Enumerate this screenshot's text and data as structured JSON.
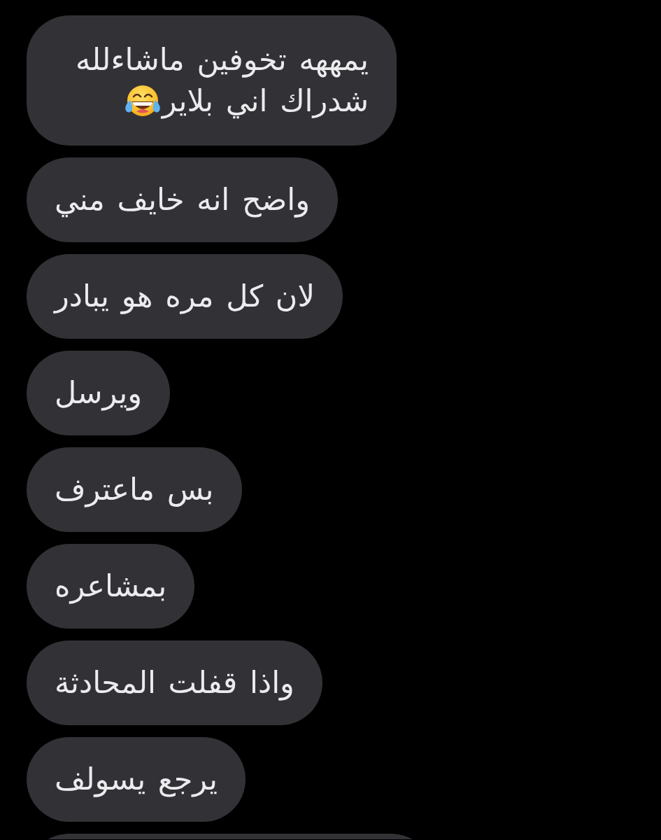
{
  "messages": [
    {
      "kind": "text",
      "lines": [
        "يمههه تخوفين ماشاءلله",
        "شدراك اني بلاير"
      ],
      "emoji": true
    },
    {
      "kind": "text",
      "lines": [
        "واضح انه خايف مني"
      ]
    },
    {
      "kind": "text",
      "lines": [
        "لان كل مره هو يبادر"
      ]
    },
    {
      "kind": "text",
      "lines": [
        "ويرسل"
      ]
    },
    {
      "kind": "text",
      "lines": [
        "بس ماعترف"
      ]
    },
    {
      "kind": "text",
      "lines": [
        "بمشاعره"
      ]
    },
    {
      "kind": "text",
      "lines": [
        "واذا قفلت المحادثة"
      ]
    },
    {
      "kind": "text",
      "lines": [
        "يرجع يسولف"
      ]
    },
    {
      "kind": "cut"
    }
  ]
}
